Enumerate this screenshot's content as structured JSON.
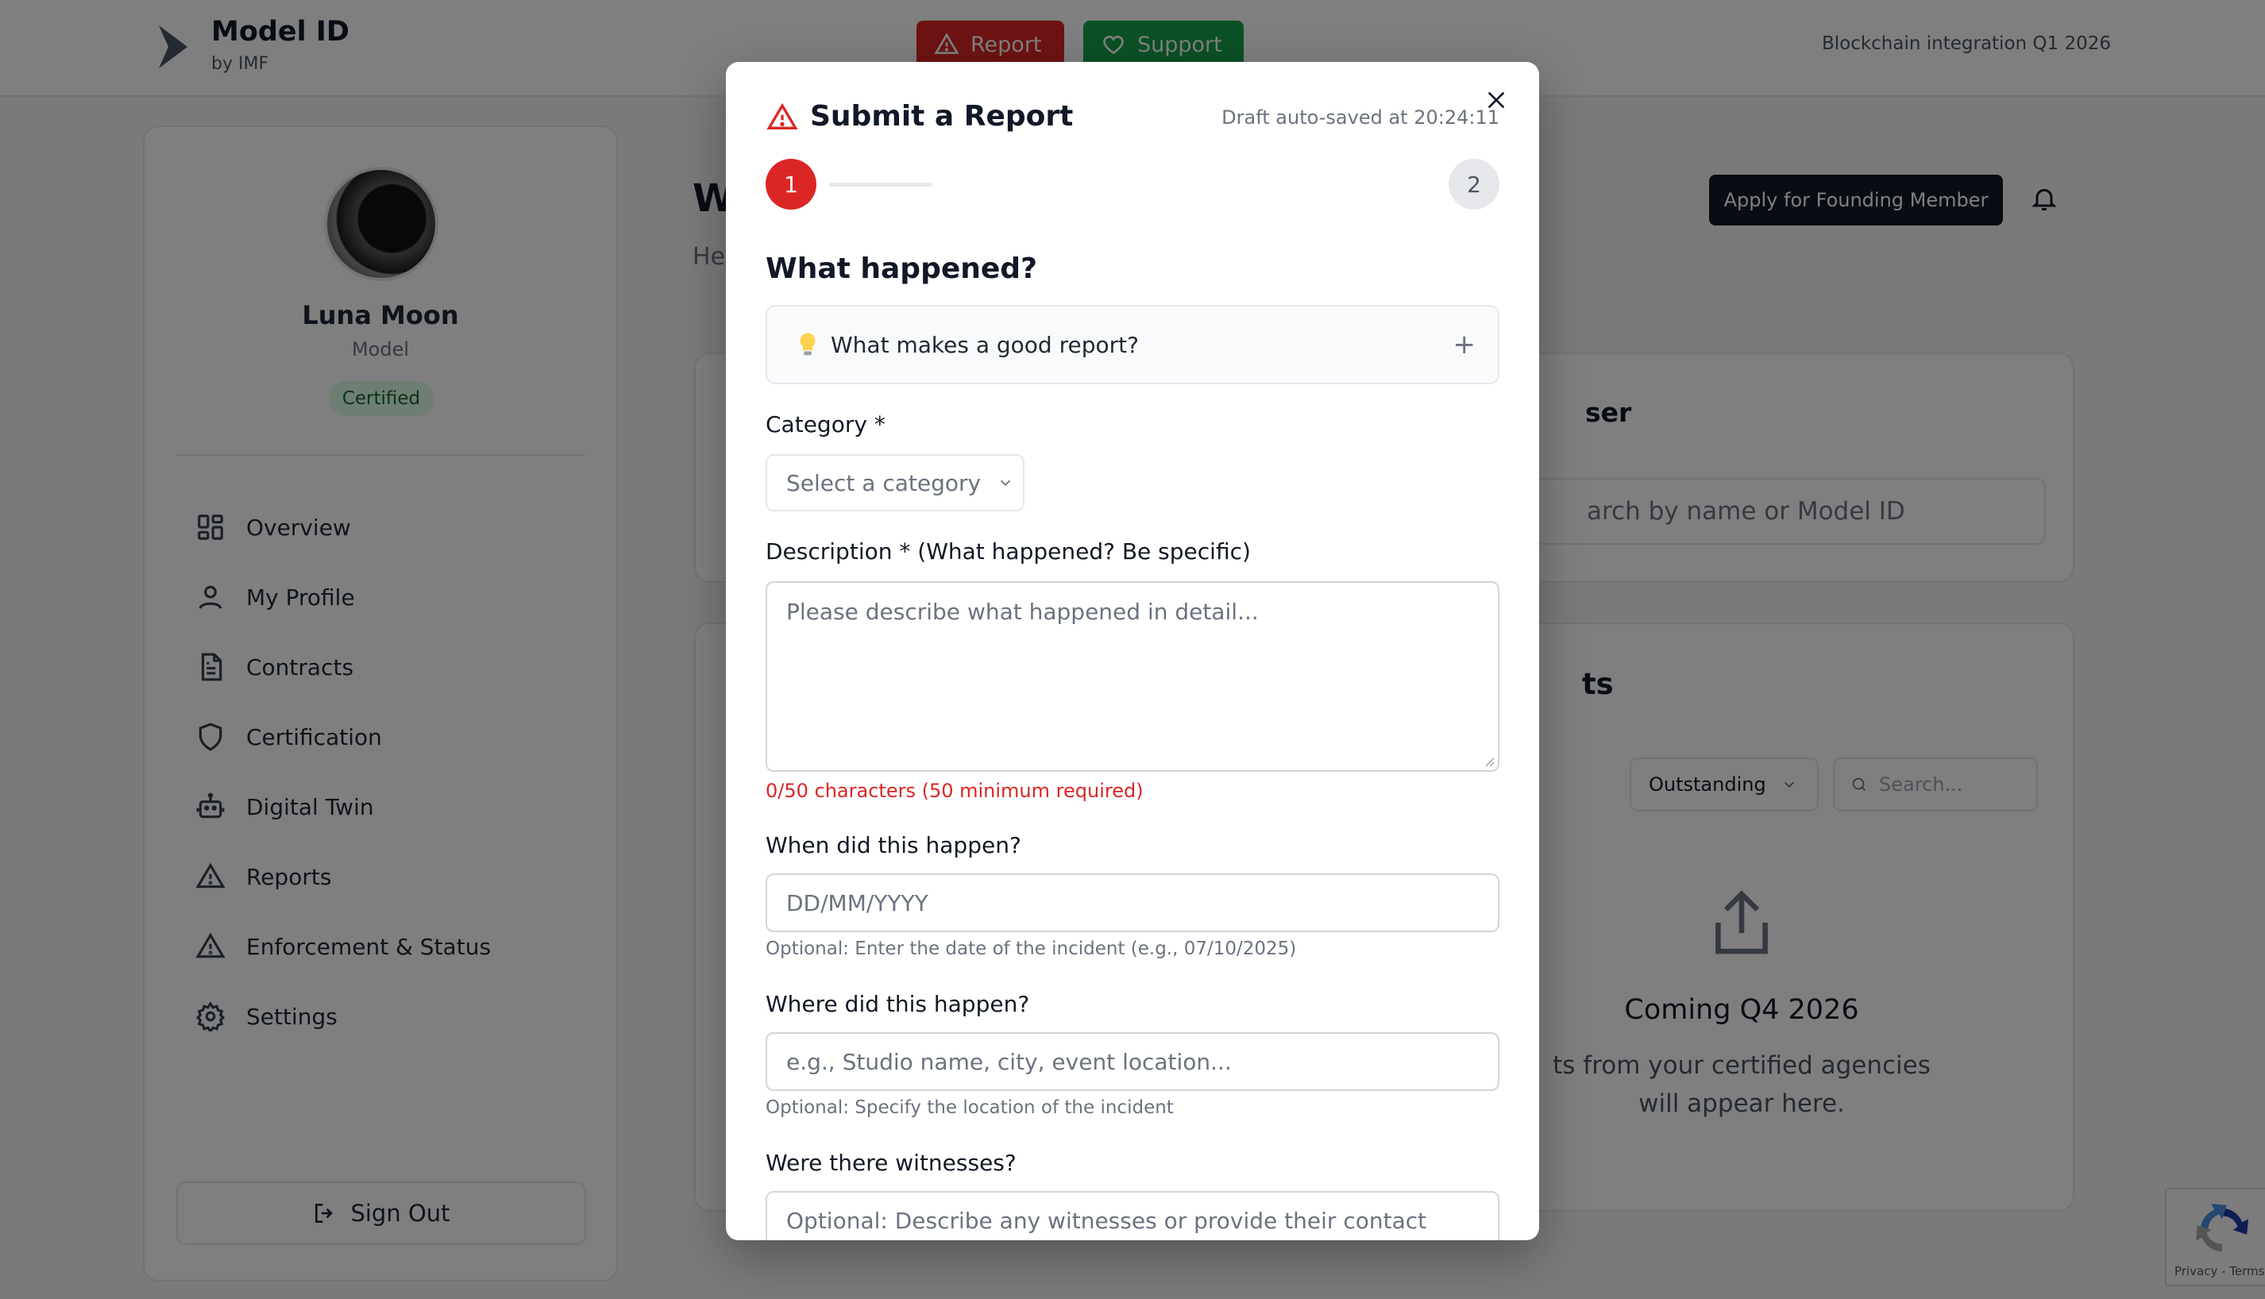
{
  "app": {
    "title": "Model ID",
    "subtitle": "by IMF",
    "report_button": "Report",
    "support_button": "Support",
    "top_note": "Blockchain integration Q1 2026"
  },
  "sidebar": {
    "user_name": "Luna Moon",
    "user_role": "Model",
    "badge": "Certified",
    "items": [
      {
        "label": "Overview",
        "icon": "grid-icon"
      },
      {
        "label": "My Profile",
        "icon": "user-icon"
      },
      {
        "label": "Contracts",
        "icon": "document-icon"
      },
      {
        "label": "Certification",
        "icon": "shield-icon"
      },
      {
        "label": "Digital Twin",
        "icon": "robot-icon"
      },
      {
        "label": "Reports",
        "icon": "warning-icon"
      },
      {
        "label": "Enforcement & Status",
        "icon": "warning-icon"
      },
      {
        "label": "Settings",
        "icon": "gear-icon"
      }
    ],
    "sign_out": "Sign Out"
  },
  "main": {
    "heading": "W",
    "subheading": "He",
    "apply_button": "Apply for Founding Member",
    "card1_title": "ser",
    "card1_search_placeholder": "arch by name or Model ID",
    "card2_title": "ts",
    "filter_status": "Outstanding",
    "filter_search_placeholder": "Search...",
    "empty_title": "Coming Q4 2026",
    "empty_text": "ts from your certified agencies will appear here."
  },
  "recaptcha": {
    "text": "Privacy - Terms"
  },
  "modal": {
    "title": "Submit a Report",
    "draft_status": "Draft auto-saved at 20:24:11",
    "step1": "1",
    "step2": "2",
    "section_title": "What happened?",
    "tips_label": "What makes a good report?",
    "tips_toggle": "+",
    "category_label": "Category *",
    "category_placeholder": "Select a category",
    "description_label": "Description * (What happened? Be specific)",
    "description_placeholder": "Please describe what happened in detail...",
    "char_count": "0/50 characters (50 minimum required)",
    "date_label": "When did this happen?",
    "date_placeholder": "DD/MM/YYYY",
    "date_hint": "Optional: Enter the date of the incident (e.g., 07/10/2025)",
    "location_label": "Where did this happen?",
    "location_placeholder": "e.g., Studio name, city, event location...",
    "location_hint": "Optional: Specify the location of the incident",
    "witness_label": "Were there witnesses?",
    "witness_placeholder": "Optional: Describe any witnesses or provide their contact"
  },
  "colors": {
    "danger": "#dc2626",
    "success": "#16a34a",
    "dark": "#111827",
    "overlay": "rgba(0,0,0,0.5)"
  }
}
